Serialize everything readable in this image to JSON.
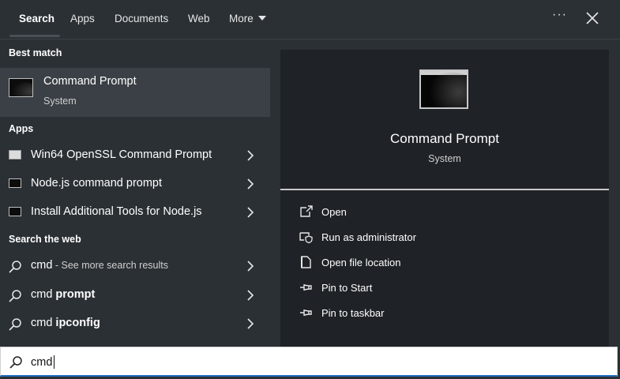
{
  "tabs": [
    "Search",
    "Apps",
    "Documents",
    "Web",
    "More"
  ],
  "left": {
    "best_match_heading": "Best match",
    "best_match": {
      "title": "Command Prompt",
      "subtitle": "System"
    },
    "apps_heading": "Apps",
    "apps": [
      "Win64 OpenSSL Command Prompt",
      "Node.js command prompt",
      "Install Additional Tools for Node.js"
    ],
    "web_heading": "Search the web",
    "web": [
      {
        "term": "cmd",
        "suffix": " - See more search results",
        "bold": ""
      },
      {
        "term": "cmd ",
        "suffix": "",
        "bold": "prompt"
      },
      {
        "term": "cmd ",
        "suffix": "",
        "bold": "ipconfig"
      }
    ]
  },
  "detail": {
    "title": "Command Prompt",
    "subtitle": "System",
    "actions": [
      "Open",
      "Run as administrator",
      "Open file location",
      "Pin to Start",
      "Pin to taskbar"
    ]
  },
  "search": {
    "value": "cmd"
  },
  "icons": {
    "more": "chevron-down-icon",
    "options": "ellipsis-icon",
    "close": "close-icon",
    "search": "search-icon",
    "chevron": "chevron-right-icon",
    "open": "open-external-icon",
    "run_admin": "shield-icon",
    "open_location": "file-icon",
    "pin_start": "pin-icon",
    "pin_taskbar": "pin-icon"
  },
  "colors": {
    "background": "#2b3035",
    "detail_pane": "#1f2327",
    "selected": "#3a4045",
    "accent": "#1f6fbf"
  }
}
